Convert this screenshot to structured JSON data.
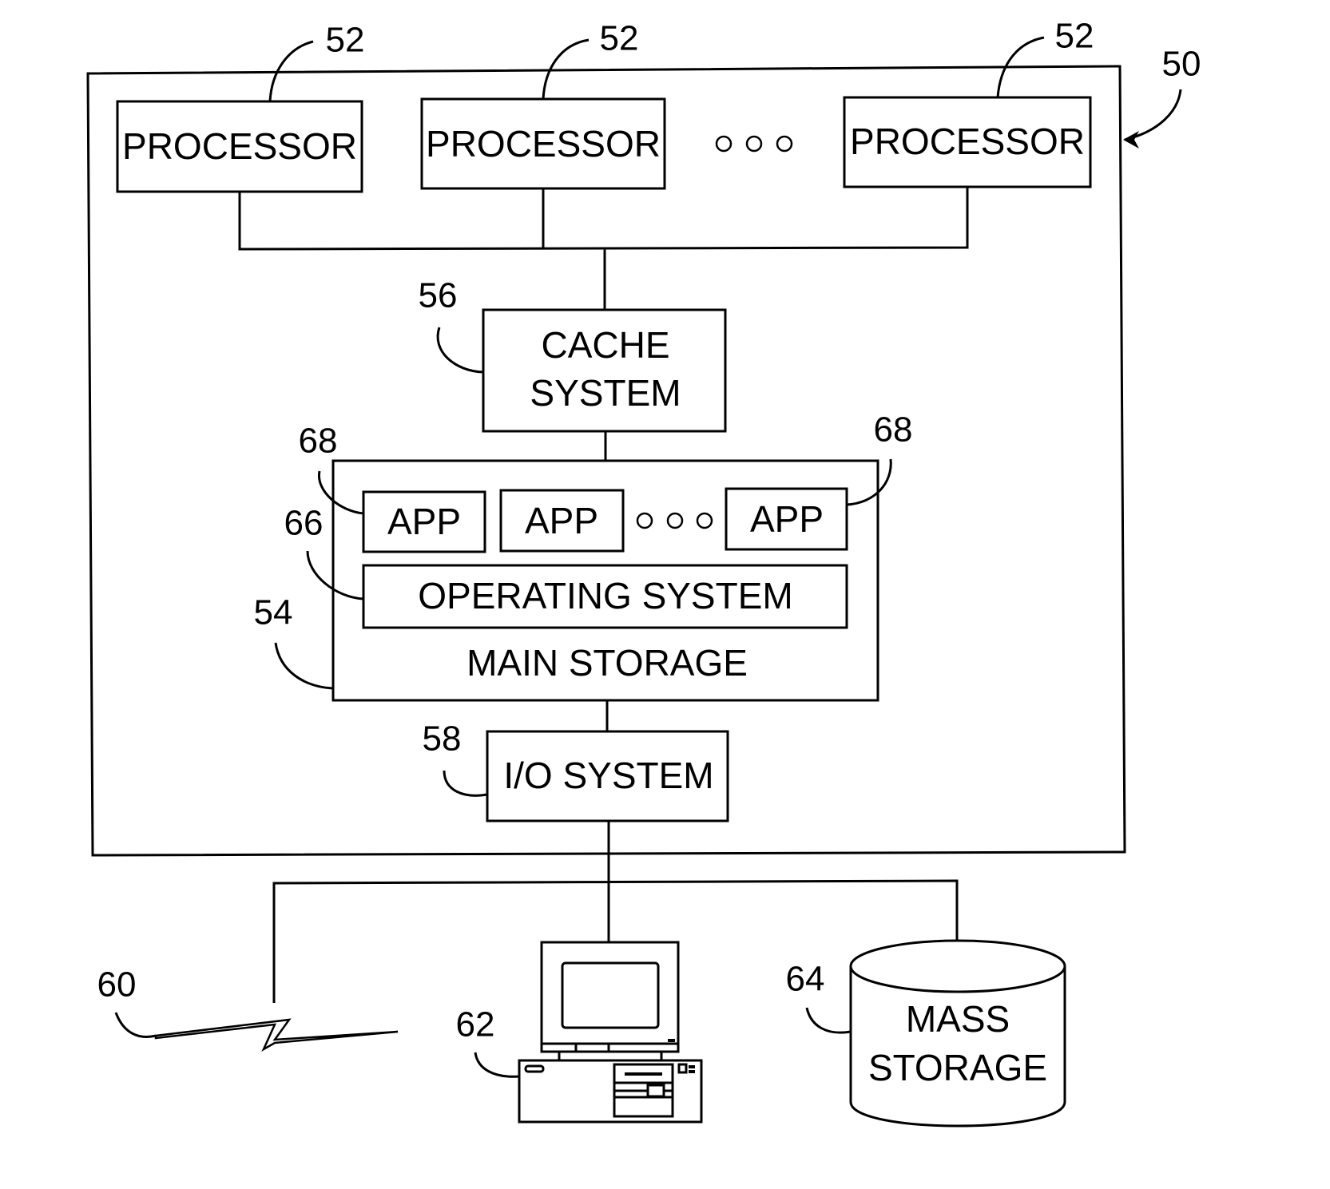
{
  "figure": {
    "system_ref": "50",
    "processors": [
      {
        "label": "PROCESSOR",
        "ref": "52"
      },
      {
        "label": "PROCESSOR",
        "ref": "52"
      },
      {
        "label": "PROCESSOR",
        "ref": "52"
      }
    ],
    "cache": {
      "line1": "CACHE",
      "line2": "SYSTEM",
      "ref": "56"
    },
    "main_storage": {
      "label": "MAIN STORAGE",
      "ref": "54"
    },
    "apps": [
      {
        "label": "APP",
        "ref": "68"
      },
      {
        "label": "APP",
        "ref": ""
      },
      {
        "label": "APP",
        "ref": "68"
      }
    ],
    "operating_system": {
      "label": "OPERATING SYSTEM",
      "ref": "66"
    },
    "io_system": {
      "label": "I/O SYSTEM",
      "ref": "58"
    },
    "network": {
      "ref": "60"
    },
    "workstation": {
      "ref": "62"
    },
    "mass_storage": {
      "line1": "MASS",
      "line2": "STORAGE",
      "ref": "64"
    }
  }
}
